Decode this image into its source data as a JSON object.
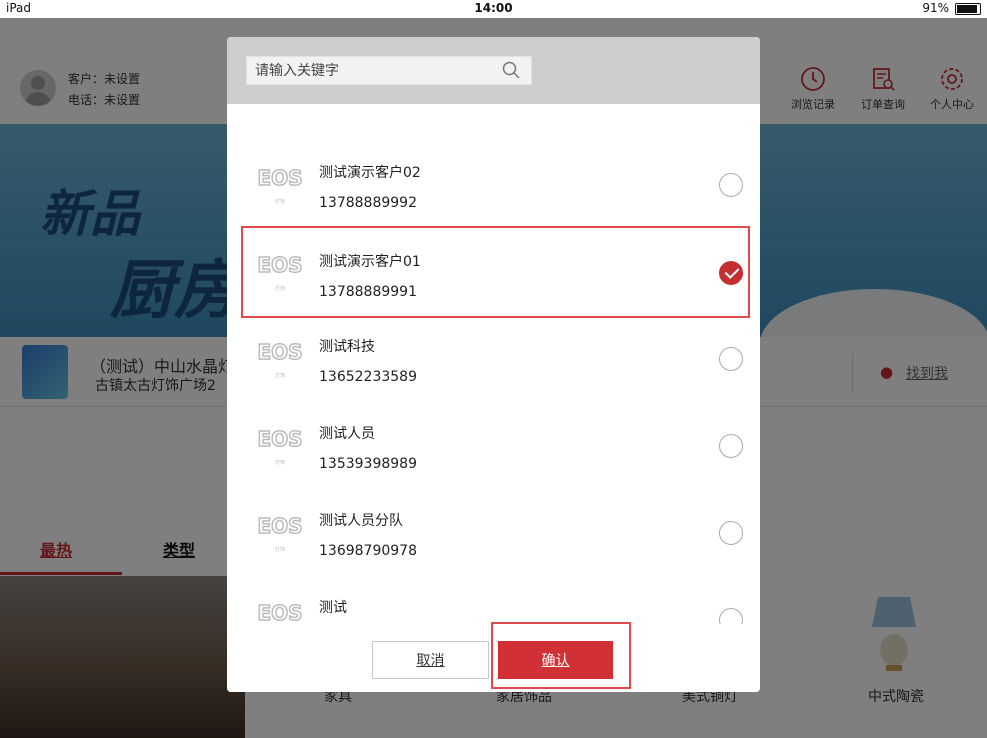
{
  "statusbar": {
    "device": "iPad",
    "time": "14:00",
    "battery": "91%"
  },
  "header": {
    "customer_label": "客户：未设置",
    "phone_label": "电话：未设置",
    "nav": [
      {
        "label": "浏览记录",
        "icon": "clock-icon"
      },
      {
        "label": "订单查询",
        "icon": "order-search-icon"
      },
      {
        "label": "个人中心",
        "icon": "gear-icon"
      }
    ]
  },
  "banner": {
    "line1": "新品",
    "line2": "厨房"
  },
  "store": {
    "name": "（测试）中山水晶灯",
    "address": "古镇太古灯饰广场2",
    "find_me": "找到我"
  },
  "tabs": [
    {
      "label": "最热",
      "active": true
    },
    {
      "label": "类型",
      "active": false
    }
  ],
  "bottom_categories": [
    "家具",
    "家居饰品",
    "美式铜灯",
    "中式陶瓷"
  ],
  "modal": {
    "search": {
      "placeholder": "请输入关键字",
      "icon": "search-icon"
    },
    "customers": [
      {
        "name": "测试演示客户02",
        "phone": "13788889992",
        "selected": false
      },
      {
        "name": "测试演示客户01",
        "phone": "13788889991",
        "selected": true
      },
      {
        "name": "测试科技",
        "phone": "13652233589",
        "selected": false
      },
      {
        "name": "测试人员",
        "phone": "13539398989",
        "selected": false
      },
      {
        "name": "测试人员分队",
        "phone": "13698790978",
        "selected": false
      },
      {
        "name": "测试",
        "phone": "",
        "selected": false
      }
    ],
    "cancel_label": "取消",
    "confirm_label": "确认"
  },
  "colors": {
    "accent": "#d13035",
    "highlight": "#e04a4d",
    "overlay": "#808080"
  }
}
